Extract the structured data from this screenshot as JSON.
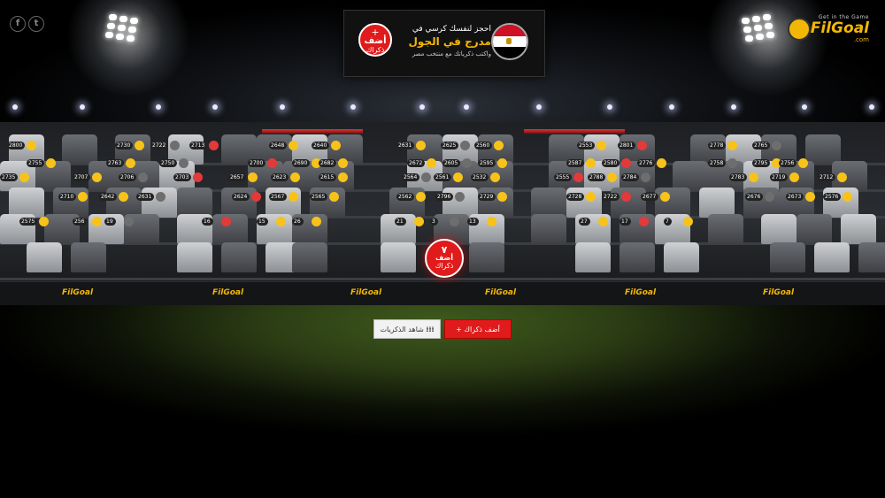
{
  "social": {
    "facebook": "f",
    "twitter": "t"
  },
  "logo": {
    "tagline": "Get in the Game",
    "name": "FilGoal",
    "suffix": ".com"
  },
  "banner": {
    "add_line1": "أضف",
    "add_line2": "ذكراك",
    "plus": "+",
    "title_line1": "احجز لنفسك كرسي في",
    "title_line2": "مدرج في الجول",
    "title_line3": "واكتب ذكرياتك مع منتخب مصر",
    "flag_colors": [
      "#ce1126",
      "#ffffff",
      "#000000"
    ]
  },
  "center_seat": {
    "number": "٧",
    "line1": "أضف",
    "line2": "ذكراك"
  },
  "buttons": {
    "view_memories": "شاهد الذكريات",
    "view_icon": "grid-icon",
    "add_memory": "+ أضف ذكراك"
  },
  "ad_board": {
    "label": "FilGoal"
  },
  "seat_numbers": [
    "2800",
    "2730",
    "2722",
    "2713",
    "2648",
    "2640",
    "2631",
    "2625",
    "2560",
    "2553",
    "2801",
    "2778",
    "2765",
    "2755",
    "2763",
    "2750",
    "2700",
    "2690",
    "2682",
    "2672",
    "2605",
    "2595",
    "2587",
    "2580",
    "2776",
    "2758",
    "2795",
    "2756",
    "2735",
    "2707",
    "2706",
    "2703",
    "2657",
    "2623",
    "2615",
    "2564",
    "2561",
    "2532",
    "2555",
    "2788",
    "2784",
    "2783",
    "2719",
    "2712",
    "2710",
    "2642",
    "2631",
    "2624",
    "2567",
    "2565",
    "2562",
    "2796",
    "2729",
    "2728",
    "2722",
    "2677",
    "2676",
    "2673",
    "2576",
    "2575",
    "256",
    "19",
    "16",
    "15",
    "26",
    "21",
    "3",
    "13",
    "27",
    "17",
    "7"
  ]
}
